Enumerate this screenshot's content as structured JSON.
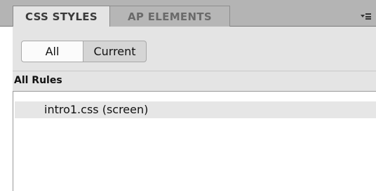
{
  "tabs": [
    {
      "label": "CSS STYLES",
      "active": true
    },
    {
      "label": "AP ELEMENTS",
      "active": false
    }
  ],
  "panel_menu_icon": "panel-options-icon",
  "view_toggle": {
    "all_label": "All",
    "current_label": "Current",
    "selected": "All"
  },
  "section": {
    "title": "All Rules"
  },
  "rules": [
    {
      "label": "intro1.css (screen)",
      "selected": true
    }
  ],
  "colors": {
    "tabbar_bg": "#b4b4b4",
    "panel_bg": "#e4e4e4",
    "selected_row": "#e6e6e6"
  }
}
